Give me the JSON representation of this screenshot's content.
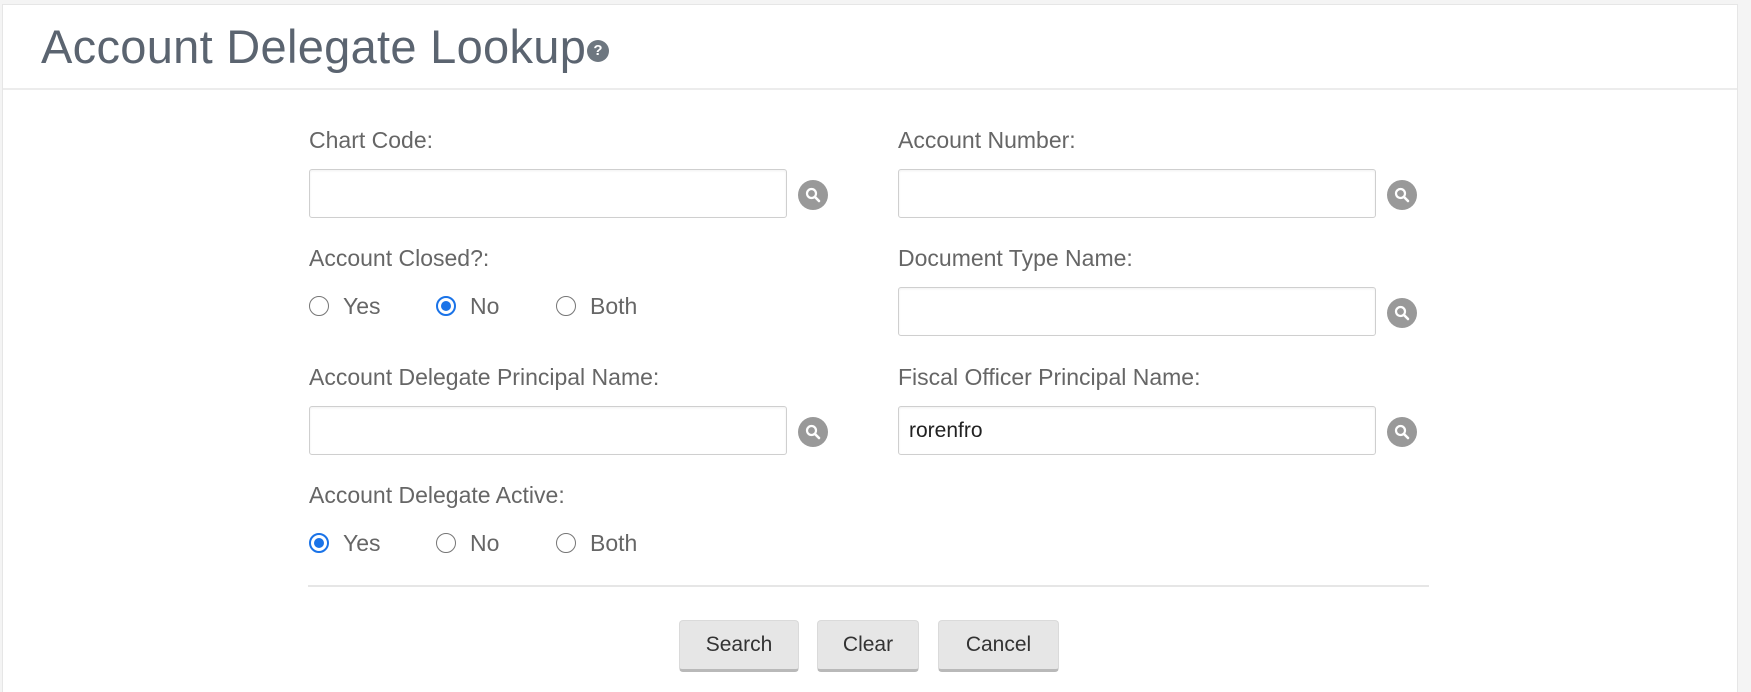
{
  "header": {
    "title": "Account Delegate Lookup",
    "help_icon": "question-circle-icon"
  },
  "form": {
    "chart_code": {
      "label": "Chart Code:",
      "value": ""
    },
    "account_number": {
      "label": "Account Number:",
      "value": ""
    },
    "account_closed": {
      "label": "Account Closed?:",
      "options": [
        "Yes",
        "No",
        "Both"
      ],
      "selected": "No"
    },
    "document_type_name": {
      "label": "Document Type Name:",
      "value": ""
    },
    "delegate_principal_name": {
      "label": "Account Delegate Principal Name:",
      "value": ""
    },
    "fiscal_officer_principal_name": {
      "label": "Fiscal Officer Principal Name:",
      "value": "rorenfro"
    },
    "delegate_active": {
      "label": "Account Delegate Active:",
      "options": [
        "Yes",
        "No",
        "Both"
      ],
      "selected": "Yes"
    },
    "lookup_icon": "search-icon"
  },
  "buttons": {
    "search": "Search",
    "clear": "Clear",
    "cancel": "Cancel"
  },
  "colors": {
    "radio_accent": "#1a73e8",
    "lookup_icon_bg": "#999999",
    "button_bg": "#e6e6e6"
  }
}
